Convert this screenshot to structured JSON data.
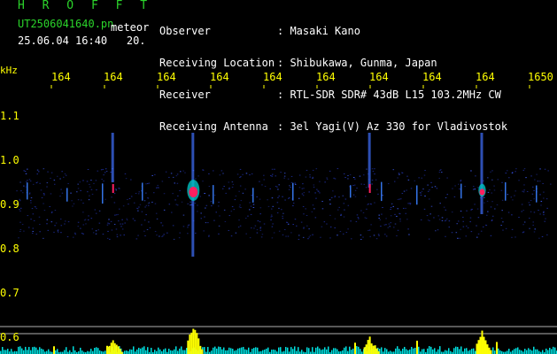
{
  "header": {
    "app_name": "H R O F F T",
    "filename": "UT2506041640.pn",
    "meteor_label": "meteor",
    "datetime": "25.06.04 16:40",
    "count": "20.",
    "fields": [
      {
        "label": "Observer",
        "value": ": Masaki Kano"
      },
      {
        "label": "Receiving Location",
        "value": ": Shibukawa, Gunma, Japan"
      },
      {
        "label": "Receiver",
        "value": ": RTL-SDR SDR# 43dB L15 103.2MHz CW"
      },
      {
        "label": "Receiving Antenna",
        "value": ": 3el Yagi(V) Az 330 for Vladivostok"
      }
    ]
  },
  "axes": {
    "unit": "kHz",
    "freq_ticks": [
      "164",
      "164",
      "164",
      "164",
      "164",
      "164",
      "164",
      "164",
      "164",
      "1650"
    ],
    "y_ticks": [
      "1.1",
      "1.0",
      "0.9",
      "0.8",
      "0.7",
      "0.6"
    ]
  },
  "colors": {
    "label_green": "#2bd42b",
    "text_white": "#ffffff",
    "axis_yellow": "#ffff00",
    "echo_red": "#ff2060",
    "noise_blue": "#2030a0",
    "bottom_cyan": "#00e0e0"
  },
  "events": [
    {
      "minute": 0.33,
      "strength": 1.0
    },
    {
      "minute": 0.87,
      "strength": 0.6
    },
    {
      "minute": 0.66,
      "strength": 0.35
    },
    {
      "minute": 0.18,
      "strength": 0.3
    }
  ]
}
